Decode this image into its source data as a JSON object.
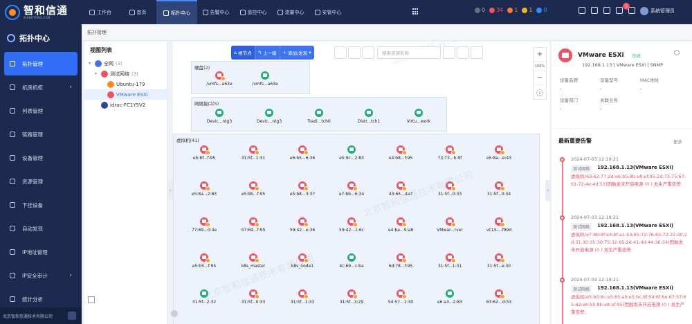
{
  "logo": {
    "cn": "智和信通",
    "en": "ZHIHETONG.COM"
  },
  "topnav": [
    {
      "label": "工作台"
    },
    {
      "label": "首页"
    },
    {
      "label": "拓扑中心"
    },
    {
      "label": "告警中心"
    },
    {
      "label": "监控中心"
    },
    {
      "label": "流量中心"
    },
    {
      "label": "安管中心"
    }
  ],
  "status_counts": [
    {
      "value": "0",
      "color": "#666e80"
    },
    {
      "value": "34",
      "color": "#f05163"
    },
    {
      "value": "1",
      "color": "#ff7a2e"
    },
    {
      "value": "1",
      "color": "#f0b429"
    },
    {
      "value": "0",
      "color": "#2f8cff"
    }
  ],
  "notification_count": "5",
  "user": {
    "name": "系统管理员"
  },
  "sidebar": {
    "title": "拓扑中心",
    "items": [
      {
        "label": "拓扑管理",
        "active": true,
        "arrow": ""
      },
      {
        "label": "机房机柜",
        "active": false,
        "arrow": "›"
      },
      {
        "label": "列表管理",
        "active": false,
        "arrow": ""
      },
      {
        "label": "链路管理",
        "active": false,
        "arrow": ""
      },
      {
        "label": "设备管理",
        "active": false,
        "arrow": ""
      },
      {
        "label": "资源管理",
        "active": false,
        "arrow": ""
      },
      {
        "label": "下挂设备",
        "active": false,
        "arrow": ""
      },
      {
        "label": "自动发现",
        "active": false,
        "arrow": ""
      },
      {
        "label": "IP地址管理",
        "active": false,
        "arrow": ""
      },
      {
        "label": "IP安全审计",
        "active": false,
        "arrow": "›"
      },
      {
        "label": "统计分析",
        "active": false,
        "arrow": ""
      }
    ],
    "footer": "北京智和信通技术有限公司"
  },
  "breadcrumb": "拓扑管理",
  "viewlist": {
    "title": "视图列表",
    "tree": [
      {
        "label": "全网",
        "count": "(3)",
        "depth": 0,
        "caret": "▾",
        "color": "#3e73f0",
        "selected": false
      },
      {
        "label": "测试网络",
        "count": "(3)",
        "depth": 1,
        "caret": "▾",
        "color": "#f05163",
        "selected": false
      },
      {
        "label": "Ubuntu-179",
        "count": "",
        "depth": 2,
        "caret": "",
        "color": "#ff8b20",
        "selected": false
      },
      {
        "label": "VMware ESXi",
        "count": "",
        "depth": 2,
        "caret": "",
        "color": "#f05163",
        "selected": true
      },
      {
        "label": "idrac-FC1Y5V2",
        "count": "",
        "depth": 1,
        "caret": "",
        "color": "#2b4a8c",
        "selected": false
      }
    ]
  },
  "toolbar": {
    "buttons": [
      "根节点",
      "上一级",
      "添加/发现"
    ],
    "search_placeholder": "搜索资源名称"
  },
  "zoom": {
    "plus": "+",
    "level": "100%",
    "minus": "−"
  },
  "groups": {
    "storage": {
      "label": "硬盘(2)"
    },
    "ports": {
      "label": "网络接口(5)"
    },
    "vms": {
      "label": "虚拟机(41)"
    }
  },
  "storage_devices": [
    {
      "label": "/vmfs...a63e",
      "color": "red"
    },
    {
      "label": "/vmfs...a63e",
      "color": "green"
    }
  ],
  "port_devices": [
    {
      "label": "Devic...ntg3",
      "color": "green"
    },
    {
      "label": "Devic...ntg3",
      "color": "green"
    },
    {
      "label": "Tradi...tch0",
      "color": "green"
    },
    {
      "label": "Distr...tch1",
      "color": "green"
    },
    {
      "label": "Virtu...work",
      "color": "green"
    }
  ],
  "vm_devices": [
    {
      "label": "e5:8f...f:95",
      "color": "red"
    },
    {
      "label": "31:5f...1:31",
      "color": "red"
    },
    {
      "label": "e6:b5...6:36",
      "color": "red"
    },
    {
      "label": "e5:9c...2:83",
      "color": "green"
    },
    {
      "label": "e4:b8...f:95",
      "color": "red"
    },
    {
      "label": "73:73...b:9f",
      "color": "red"
    },
    {
      "label": "e5:8a...e:43",
      "color": "red"
    },
    {
      "label": "e5:8a...2:83",
      "color": "red"
    },
    {
      "label": "e5:9b...f:95",
      "color": "red"
    },
    {
      "label": "e5:b8...3:37",
      "color": "red"
    },
    {
      "label": "e7:bb...6:34",
      "color": "red"
    },
    {
      "label": "43:65...4a7",
      "color": "red"
    },
    {
      "label": "31:5f...0:33",
      "color": "red"
    },
    {
      "label": "31:5f...0:34",
      "color": "red"
    },
    {
      "label": "77:69...0:4e",
      "color": "red"
    },
    {
      "label": "57:69...f:95",
      "color": "red"
    },
    {
      "label": "59:42...e:36",
      "color": "red"
    },
    {
      "label": "59:42...1:6c",
      "color": "red"
    },
    {
      "label": "e4:ba...9:a8",
      "color": "red"
    },
    {
      "label": "VMwar...rver",
      "color": "red"
    },
    {
      "label": "vCLS-...f99d",
      "color": "red"
    },
    {
      "label": "e5:b5...f:95",
      "color": "red"
    },
    {
      "label": "k8s_master",
      "color": "red"
    },
    {
      "label": "k8s_node1",
      "color": "red"
    },
    {
      "label": "4c:69...c:ba",
      "color": "green"
    },
    {
      "label": "6d:78...f:95",
      "color": "red"
    },
    {
      "label": "31:5f...1:31",
      "color": "red"
    },
    {
      "label": "31:5f...e:30",
      "color": "red"
    },
    {
      "label": "31:5f...2:32",
      "color": "green"
    },
    {
      "label": "31:5f...0:33",
      "color": "red"
    },
    {
      "label": "31:5f...1:33",
      "color": "red"
    },
    {
      "label": "31:5f...3:29",
      "color": "red"
    },
    {
      "label": "54:57...1:30",
      "color": "red"
    },
    {
      "label": "e6:a3...2:83",
      "color": "green"
    },
    {
      "label": "63:62...d:53",
      "color": "red"
    }
  ],
  "device_detail": {
    "name": "VMware ESXi",
    "status": "在线",
    "sub": "192.168.1.13 | VMware ESXi | SNMP",
    "props": [
      {
        "key": "设备品牌",
        "value": "-"
      },
      {
        "key": "设备型号",
        "value": "-"
      },
      {
        "key": "MAC地址",
        "value": "-"
      },
      {
        "key": "设备部门",
        "value": "-"
      },
      {
        "key": "关联业务",
        "value": "-"
      }
    ]
  },
  "alarms": {
    "title": "最新重要告警",
    "more": "更多",
    "items": [
      {
        "time": "2024-07-03 12:19:21",
        "tag": "测试网络",
        "source": "192.168.1.13(VMware ESXi)",
        "message": "虚拟机(63:62:77:2d:e6:b5:8b:e8:af:95:2d:73:75:67:61:72:4e:4d:53)因触发未开启电源 (0 ) 发生严重告警:"
      },
      {
        "time": "2024-07-03 12:19:21",
        "tag": "测试网络",
        "source": "192.168.1.13(VMware ESXi)",
        "message": "虚拟机(e7:bb:9f:e4:bf:a1:53:65:72:76:65:72:32:30:2d:31:30:35:30:75:32:65:2d:41:4d:44:36:34)因触发未开启电源 (0 ) 发生严重告警:"
      },
      {
        "time": "2024-07-03 12:19:21",
        "tag": "测试网络",
        "source": "192.168.1.13(VMware ESXi)",
        "message": "虚拟机(e5:b5:8c:e5:85:a5:e5:bc:8f:54:6f:6e:67:57:65:62:e6:b5:8b:e8:af:95)因触发未开启电源 (0 ) 发生严重告警:"
      }
    ]
  },
  "watermark": "北京智和信通技术有限公司"
}
